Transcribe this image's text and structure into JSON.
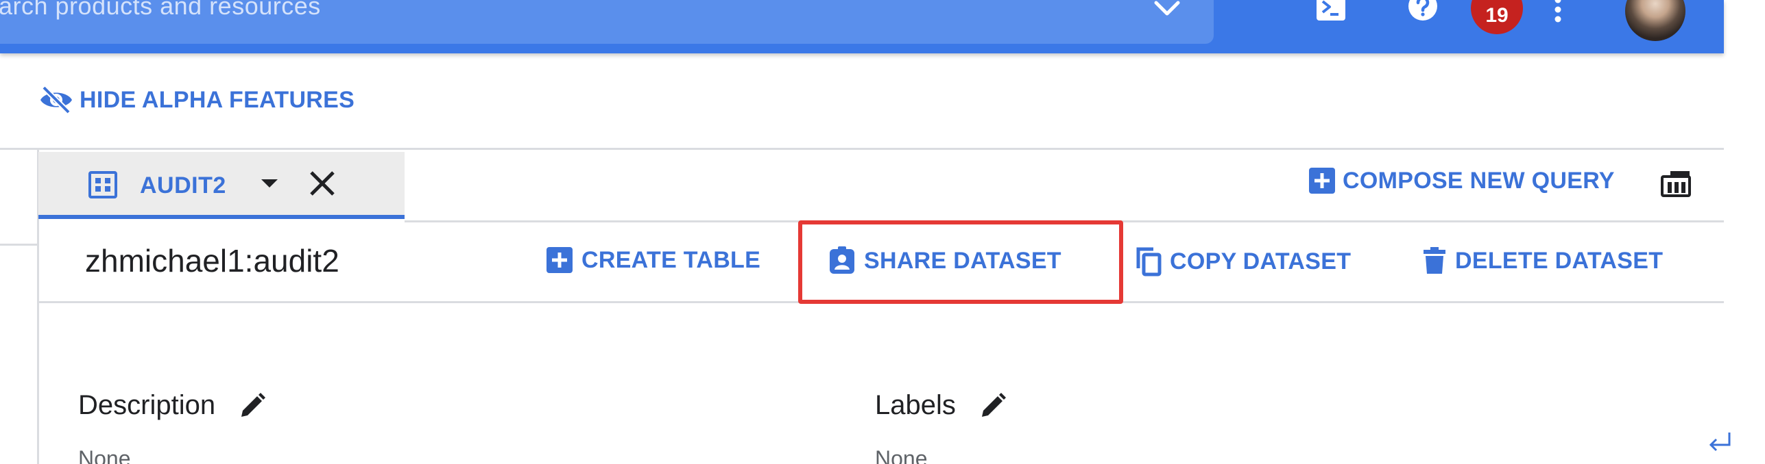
{
  "header": {
    "search_placeholder": "arch products and resources",
    "icons": [
      "search-dropdown-icon",
      "cloud-shell-icon",
      "help-icon",
      "more-vert-icon",
      "avatar"
    ],
    "notification_count": "19",
    "brand_color": "#3b78e7"
  },
  "alpha": {
    "label": "HIDE ALPHA FEATURES",
    "icon": "eye-off-icon"
  },
  "tab": {
    "label": "AUDIT2",
    "icon": "dataset-grid-icon"
  },
  "compose": {
    "label": "COMPOSE NEW QUERY",
    "icon": "add-box-icon"
  },
  "dataset": {
    "title": "zhmichael1:audit2",
    "actions": [
      {
        "label": "CREATE TABLE",
        "icon": "add-box-icon"
      },
      {
        "label": "SHARE DATASET",
        "icon": "person-badge-icon",
        "highlighted": true
      },
      {
        "label": "COPY DATASET",
        "icon": "copy-icon"
      },
      {
        "label": "DELETE DATASET",
        "icon": "trash-icon"
      }
    ]
  },
  "details": {
    "description": {
      "label": "Description",
      "value": "None"
    },
    "labels": {
      "label": "Labels",
      "value": "None"
    }
  },
  "colors": {
    "accent": "#3b72d8",
    "highlight_border": "#e53935",
    "notification_badge": "#c5221f"
  }
}
